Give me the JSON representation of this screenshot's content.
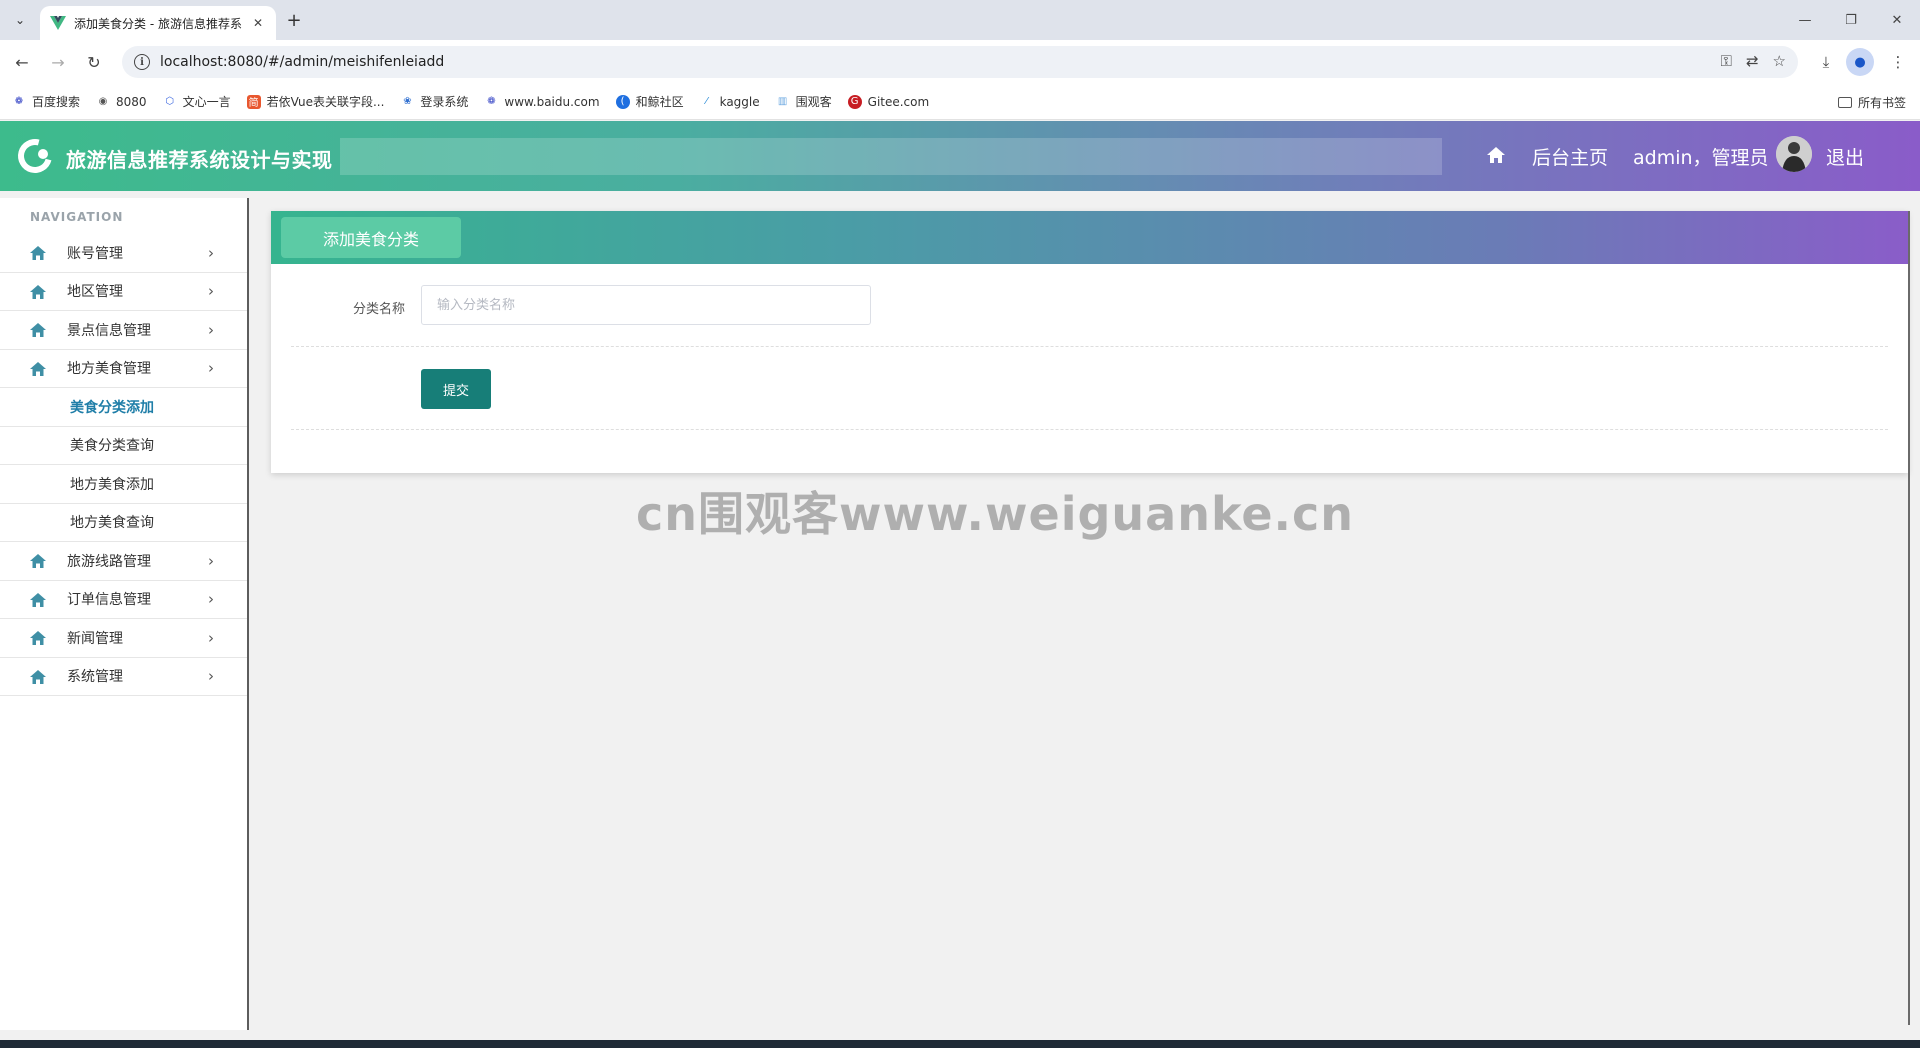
{
  "browser": {
    "tab_title": "添加美食分类 - 旅游信息推荐系",
    "url": "localhost:8080/#/admin/meishifenleiadd",
    "bookmarks": [
      {
        "label": "百度搜索",
        "icon": "baidu-icon"
      },
      {
        "label": "8080",
        "icon": "globe-icon"
      },
      {
        "label": "文心一言",
        "icon": "wenxin-icon"
      },
      {
        "label": "若依Vue表关联字段...",
        "icon": "jian-icon"
      },
      {
        "label": "登录系统",
        "icon": "lotus-icon"
      },
      {
        "label": "www.baidu.com",
        "icon": "baidu-icon"
      },
      {
        "label": "和鲸社区",
        "icon": "heywhale-icon"
      },
      {
        "label": "kaggle",
        "icon": "kaggle-icon"
      },
      {
        "label": "围观客",
        "icon": "weiguanke-icon"
      },
      {
        "label": "Gitee.com",
        "icon": "gitee-icon"
      }
    ],
    "all_bookmarks": "所有书签"
  },
  "header": {
    "title": "旅游信息推荐系统设计与实现",
    "home_link": "后台主页",
    "user": "admin，管理员",
    "logout": "退出"
  },
  "sidebar": {
    "caption": "NAVIGATION",
    "groups_top": [
      {
        "label": "账号管理"
      },
      {
        "label": "地区管理"
      },
      {
        "label": "景点信息管理"
      },
      {
        "label": "地方美食管理"
      }
    ],
    "sub_items": [
      {
        "label": "美食分类添加",
        "active": true
      },
      {
        "label": "美食分类查询"
      },
      {
        "label": "地方美食添加"
      },
      {
        "label": "地方美食查询"
      }
    ],
    "groups_bottom": [
      {
        "label": "旅游线路管理"
      },
      {
        "label": "订单信息管理"
      },
      {
        "label": "新闻管理"
      },
      {
        "label": "系统管理"
      }
    ]
  },
  "form": {
    "tab_label": "添加美食分类",
    "field_label": "分类名称",
    "field_placeholder": "输入分类名称",
    "field_value": "",
    "submit": "提交"
  },
  "watermark": "cn围观客www.weiguanke.cn",
  "colors": {
    "header_start": "#3dbb8c",
    "header_end": "#8a5cc9",
    "submit": "#177e78",
    "active_sub": "#1f7ea8"
  }
}
